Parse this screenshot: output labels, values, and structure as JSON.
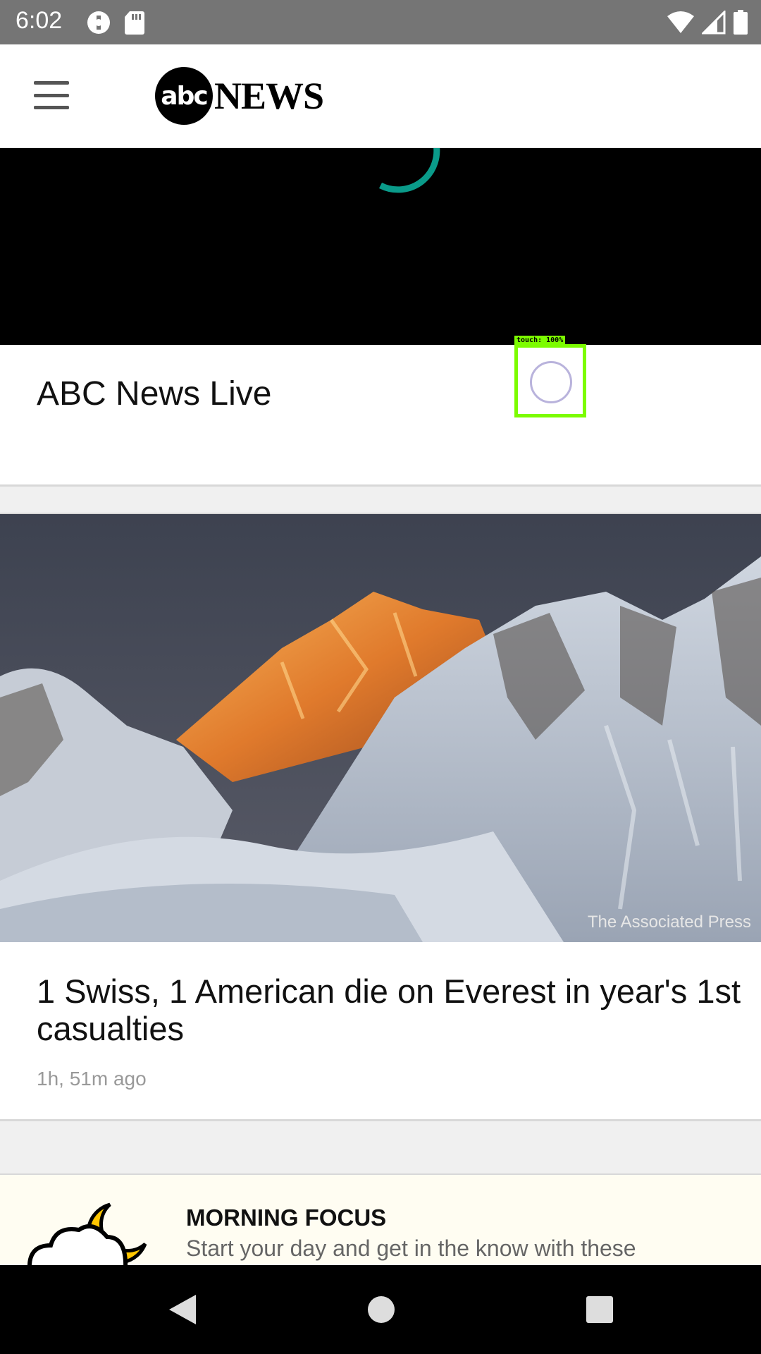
{
  "status_bar": {
    "time": "6:02",
    "icons_left": [
      "data-saver-icon",
      "sd-card-icon"
    ],
    "icons_right": [
      "wifi-icon",
      "cellular-signal-icon",
      "battery-icon"
    ]
  },
  "header": {
    "menu_icon": "hamburger-menu-icon",
    "logo_abc": "abc",
    "logo_news": "NEWS"
  },
  "video": {
    "state": "loading",
    "spinner_color": "#0a9b8a"
  },
  "live": {
    "title": "ABC News Live"
  },
  "touch_overlay": {
    "label": "touch: 100%",
    "color": "#7cfc00"
  },
  "story": {
    "image_alt": "Sunlit Mount Everest peak above snowy ridges",
    "credit": "The Associated Press",
    "headline": "1 Swiss, 1 American die on Everest in year's 1st casualties",
    "time": "1h, 51m ago"
  },
  "morning_focus": {
    "icon": "moon-cloud-icon",
    "title": "MORNING FOCUS",
    "description": "Start your day and get in the know with these"
  },
  "nav": {
    "back": "back-icon",
    "home": "home-icon",
    "recents": "recents-icon"
  }
}
